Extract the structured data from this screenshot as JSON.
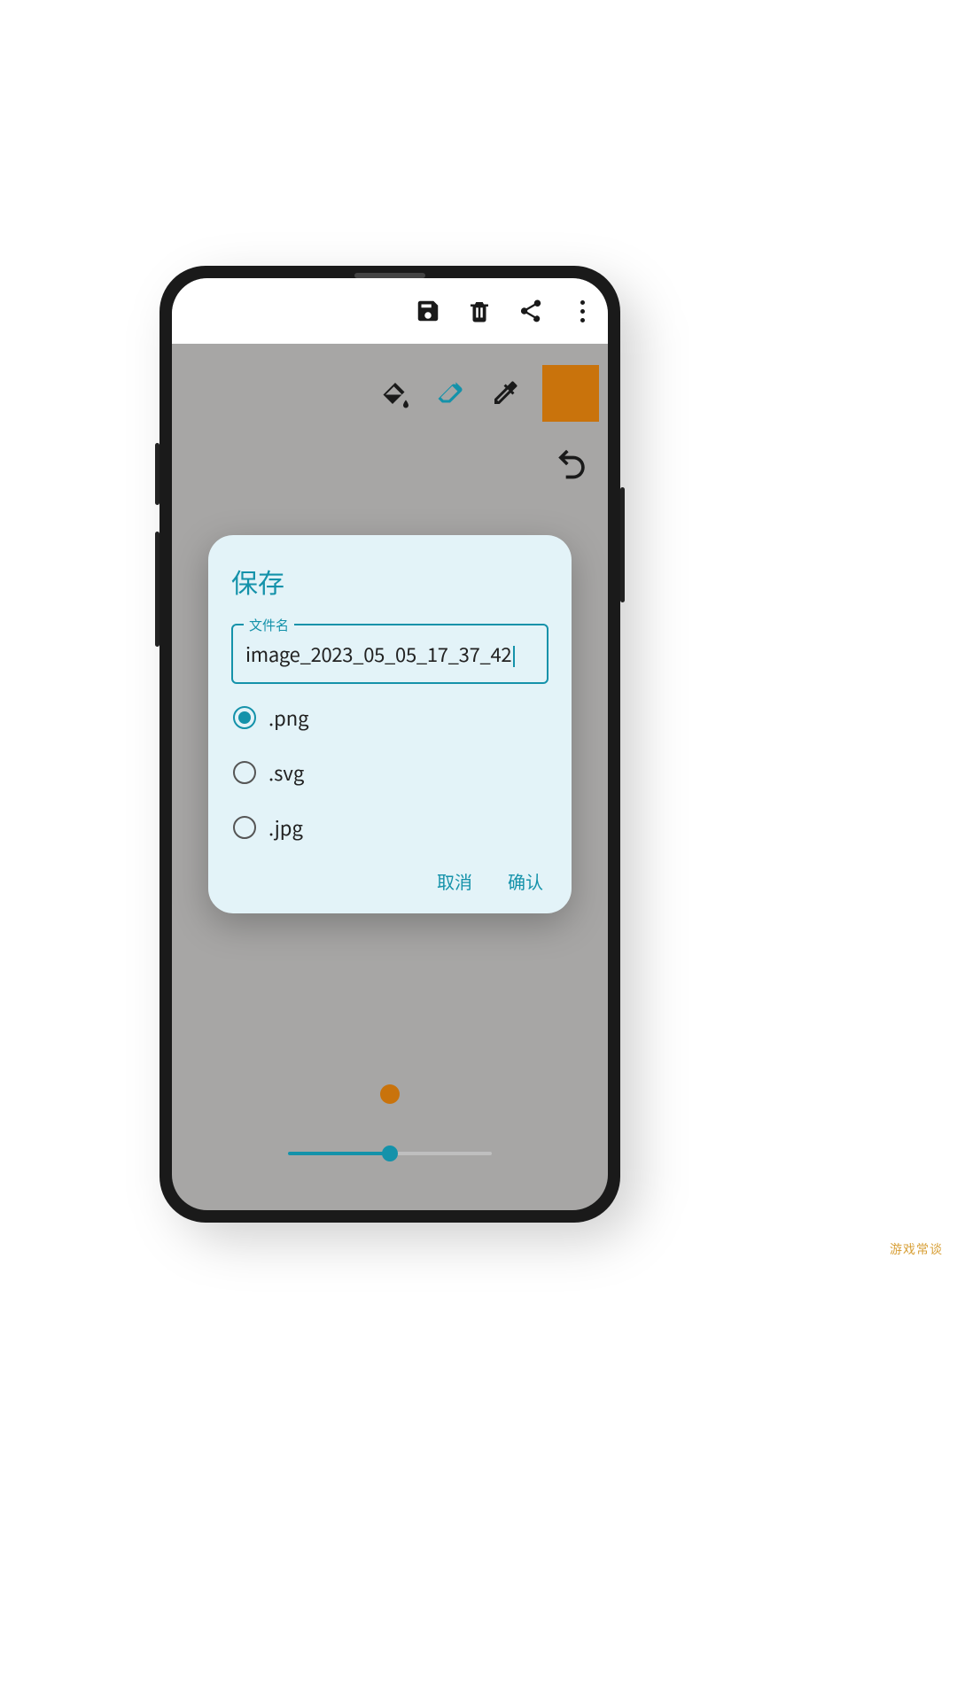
{
  "appbar": {
    "save_icon": "save",
    "delete_icon": "delete",
    "share_icon": "share",
    "more_icon": "more-vert"
  },
  "tools": {
    "fill_icon": "paint-bucket",
    "eraser_icon": "eraser",
    "eyedropper_icon": "eyedropper",
    "current_color": "#c9730c",
    "undo_icon": "undo"
  },
  "brush": {
    "preview_color": "#c9730c",
    "slider_value_pct": 50
  },
  "dialog": {
    "title": "保存",
    "field_label": "文件名",
    "filename_value": "image_2023_05_05_17_37_42",
    "formats": [
      {
        "label": ".png",
        "checked": true
      },
      {
        "label": ".svg",
        "checked": false
      },
      {
        "label": ".jpg",
        "checked": false
      }
    ],
    "cancel_label": "取消",
    "confirm_label": "确认"
  },
  "watermark": "游戏常谈"
}
